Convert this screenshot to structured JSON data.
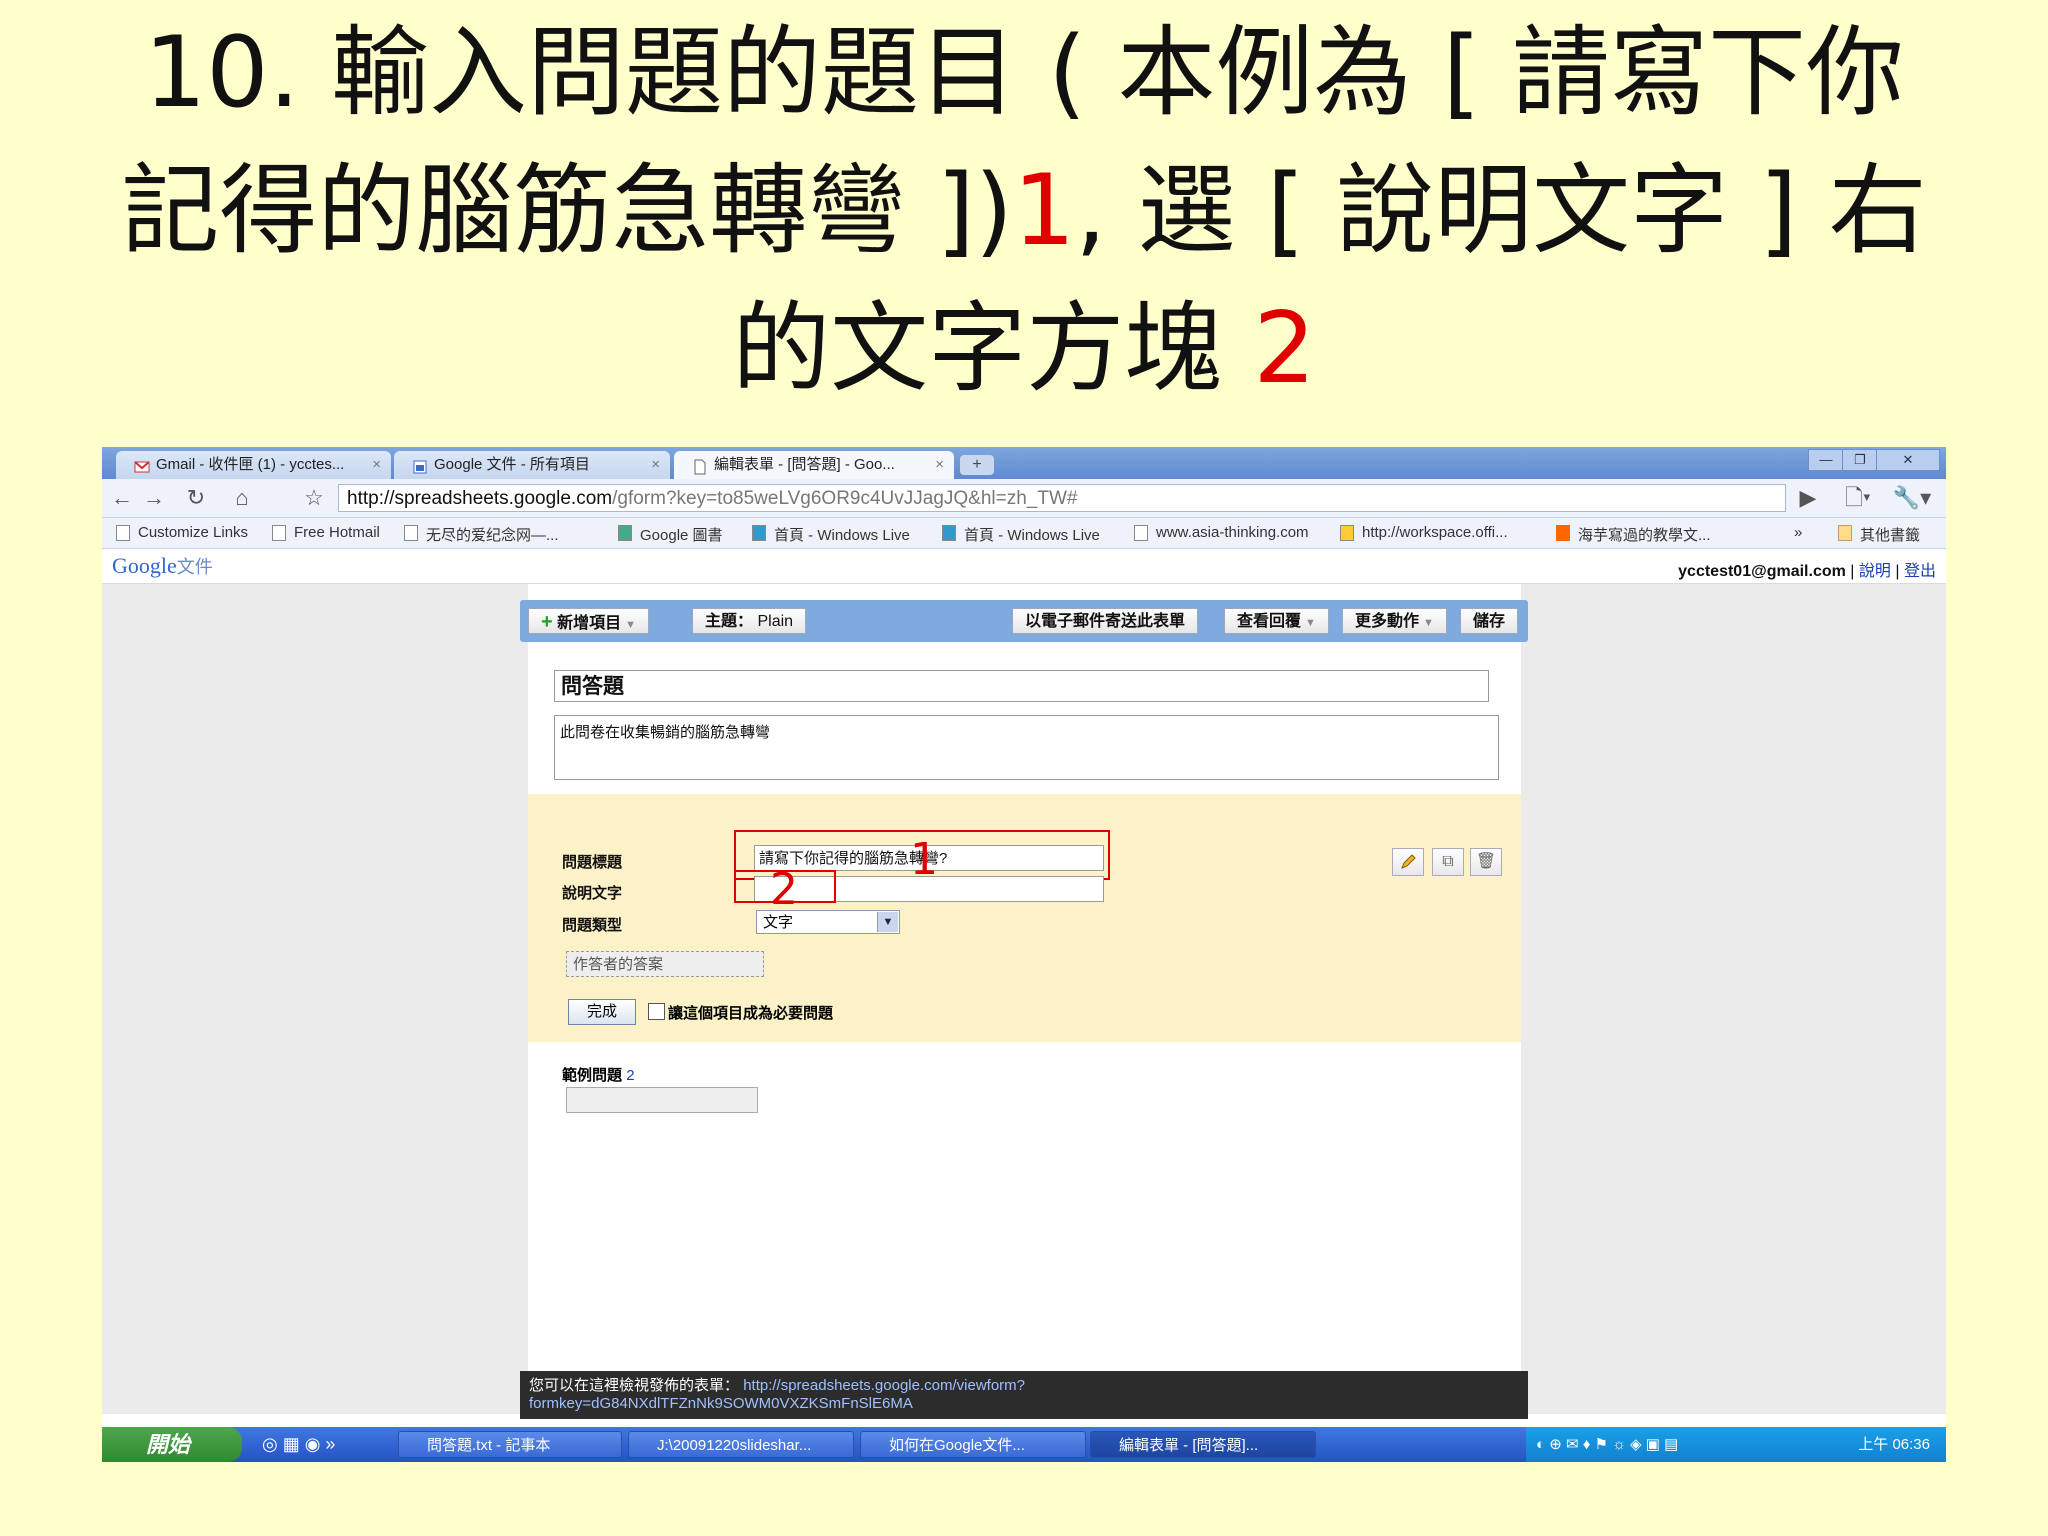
{
  "slide": {
    "title_line1": "10. 輸入問題的題目 ( 本例為 [ 請寫下你",
    "title_line2_a": "記得的腦筋急轉彎 ])",
    "title_line2_num": "1",
    "title_line2_b": ", 選 [ 說明文字 ] 右",
    "title_line3_a": "的文字方塊 ",
    "title_line3_num": "2"
  },
  "browser": {
    "tabs": [
      {
        "label": "Gmail - 收件匣 (1) - ycctes...",
        "close": "×"
      },
      {
        "label": "Google 文件 - 所有項目",
        "close": "×"
      },
      {
        "label": "編輯表單 - [問答題] - Goo...",
        "close": "×"
      }
    ],
    "new_tab": "+",
    "url_main": "http://spreadsheets.google.com",
    "url_rest": "/gform?key=to85weLVg6OR9c4UvJJagJQ&hl=zh_TW#",
    "bookmarks": [
      "Customize Links",
      "Free Hotmail",
      "无尽的爱纪念网—...",
      "Google 圖書",
      "首頁 - Windows Live",
      "首頁 - Windows Live",
      "www.asia-thinking.com",
      "http://workspace.offi...",
      "海芋寫過的教學文...",
      "»",
      "其他書籤"
    ]
  },
  "app": {
    "logo": "Google",
    "logo_sub": "文件",
    "user_email": "ycctest01@gmail.com",
    "help": "說明",
    "logout": "登出",
    "sep": "|"
  },
  "form_toolbar": {
    "add_item": "新增項目",
    "theme": "主題：",
    "theme_value": "Plain",
    "email_form": "以電子郵件寄送此表單",
    "view_responses": "查看回覆",
    "more_actions": "更多動作",
    "save": "儲存"
  },
  "form": {
    "title": "問答題",
    "description": "此問卷在收集暢銷的腦筋急轉彎"
  },
  "question": {
    "title_label": "問題標題",
    "title_value": "請寫下你記得的腦筋急轉彎?",
    "help_label": "說明文字",
    "help_value": "",
    "type_label": "問題類型",
    "type_value": "文字",
    "answer_placeholder": "作答者的答案",
    "done": "完成",
    "required_label": "讓這個項目成為必要問題",
    "marker1": "1",
    "marker2": "2"
  },
  "question2": {
    "label": "範例問題",
    "number": "2"
  },
  "footer": {
    "text": "您可以在這裡檢視發佈的表單：",
    "link1": "http://spreadsheets.google.com/viewform?",
    "link2": "formkey=dG84NXdlTFZnNk9SOWM0VXZKSmFnSlE6MA"
  },
  "taskbar": {
    "start": "開始",
    "tasks": [
      "問答題.txt - 記事本",
      "J:\\20091220slideshar...",
      "如何在Google文件...",
      "編輯表單 - [問答題]..."
    ],
    "clock": "上午 06:36"
  }
}
